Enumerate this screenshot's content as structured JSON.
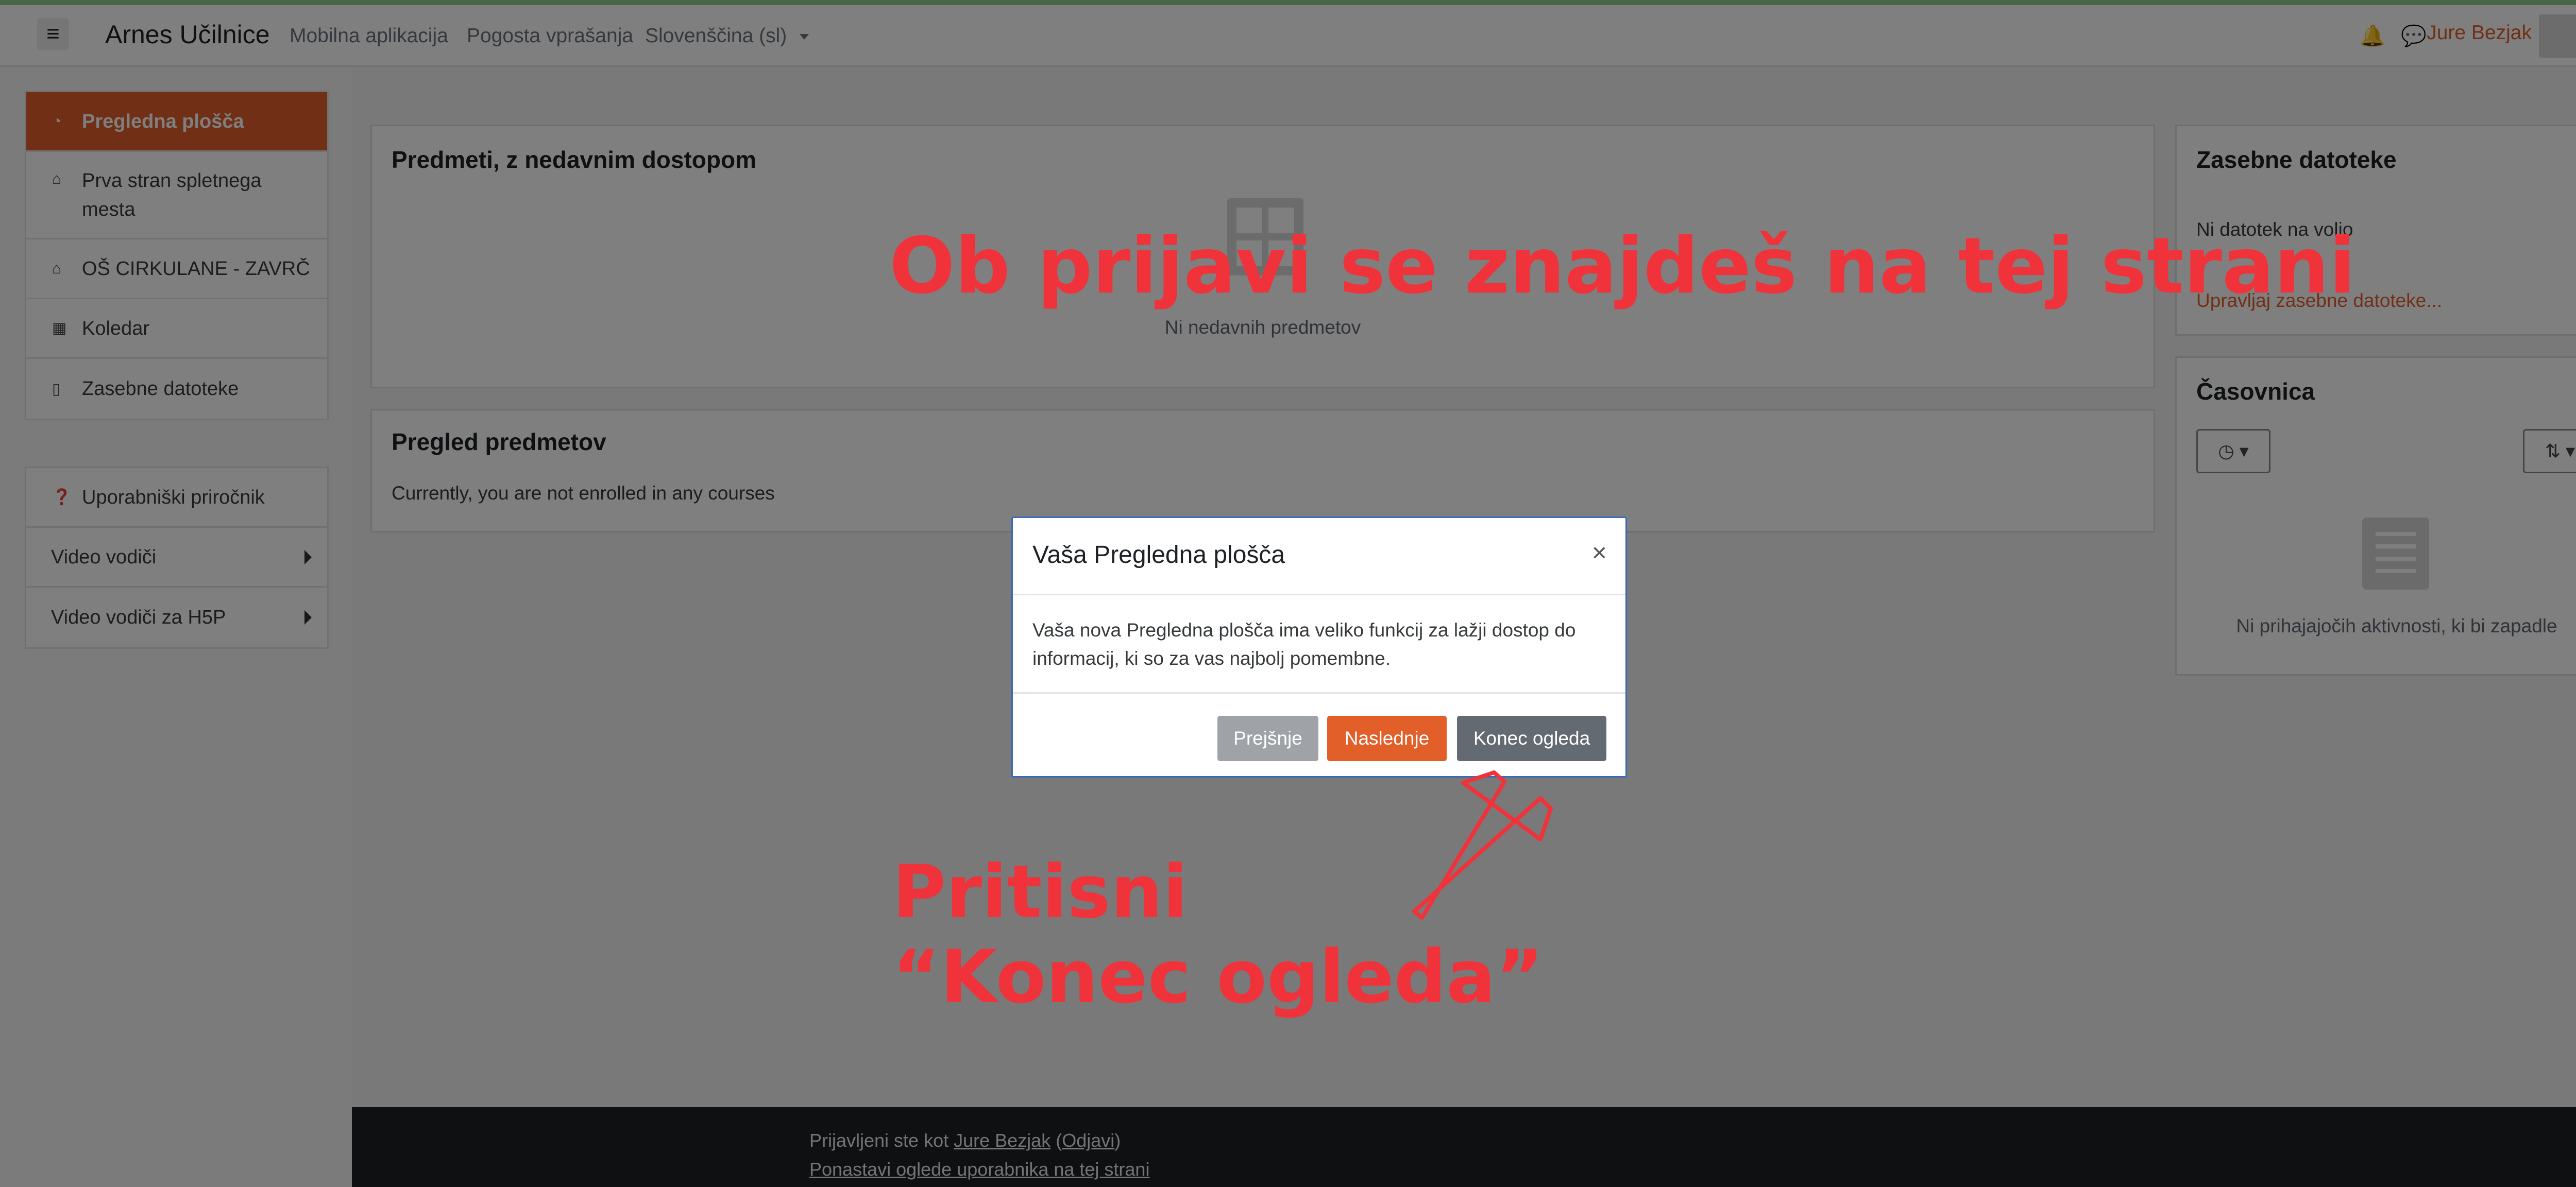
{
  "navbar": {
    "brand": "Arnes Učilnice",
    "links": [
      "Mobilna aplikacija",
      "Pogosta vprašanja",
      "Slovenščina (sl)"
    ],
    "user": "Jure Bezjak"
  },
  "sidebar": {
    "primary": [
      "Pregledna plošča",
      "Prva stran spletnega mesta",
      "OŠ CIRKULANE - ZAVRČ",
      "Koledar",
      "Zasebne datoteke"
    ],
    "secondary": [
      "Uporabniški priročnik",
      "Video vodiči",
      "Video vodiči za H5P"
    ]
  },
  "main": {
    "recent_title": "Predmeti, z nedavnim dostopom",
    "recent_empty": "Ni nedavnih predmetov",
    "overview_title": "Pregled predmetov",
    "overview_text": "Currently, you are not enrolled in any courses"
  },
  "right": {
    "files_title": "Zasebne datoteke",
    "files_empty": "Ni datotek na voljo",
    "files_link": "Upravljaj zasebne datoteke...",
    "timeline_title": "Časovnica",
    "timeline_empty": "Ni prihajajočih aktivnosti, ki bi zapadle"
  },
  "footer": {
    "logged_prefix": "Prijavljeni ste kot ",
    "user": "Jure Bezjak",
    "logout": "Odjavi",
    "reset": "Ponastavi oglede uporabnika na tej strani"
  },
  "modal": {
    "title": "Vaša Pregledna plošča",
    "close": "×",
    "body_line1": "Vaša nova Pregledna plošča ima veliko funkcij za lažji dostop do",
    "body_line2": "informacij, ki so za vas najbolj pomembne.",
    "prev": "Prejšnje",
    "next": "Naslednje",
    "end": "Konec ogleda"
  },
  "annotations": {
    "headline": "Ob prijavi se znajdeš na tej strani",
    "press_line1": "Pritisni",
    "press_line2": "“Konec ogleda”"
  }
}
